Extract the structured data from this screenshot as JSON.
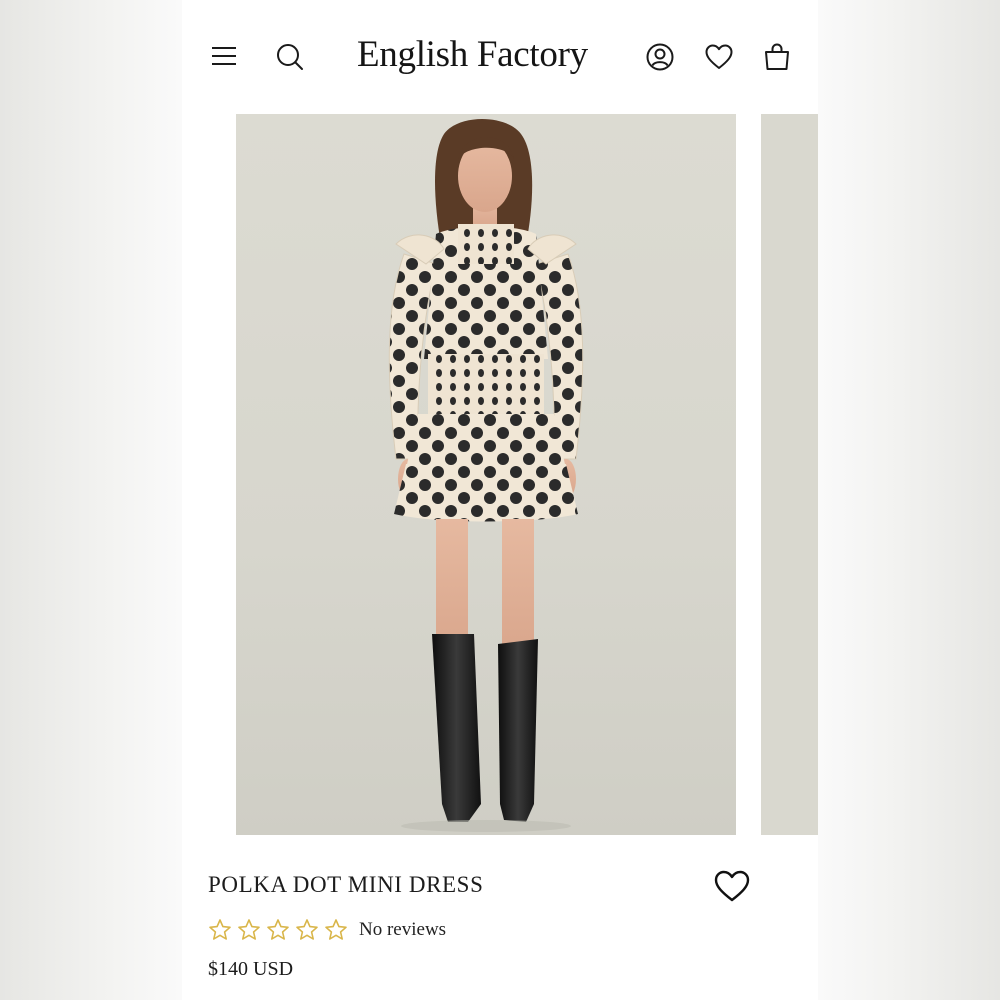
{
  "header": {
    "brand": "English Factory",
    "icons": {
      "menu": "hamburger-menu-icon",
      "search": "search-icon",
      "account": "account-icon",
      "wishlist": "heart-icon",
      "cart": "shopping-bag-icon"
    }
  },
  "product": {
    "title": "POLKA DOT MINI DRESS",
    "rating": {
      "stars_filled": 0,
      "stars_total": 5,
      "star_color": "#d9b64a"
    },
    "reviews_text": "No reviews",
    "price": "$140 USD"
  },
  "colors": {
    "text": "#1c1c1c",
    "photo_background": "#dcdbd2",
    "dress_cream": "#f1e7d6",
    "dot_color": "#2b2b2b"
  }
}
